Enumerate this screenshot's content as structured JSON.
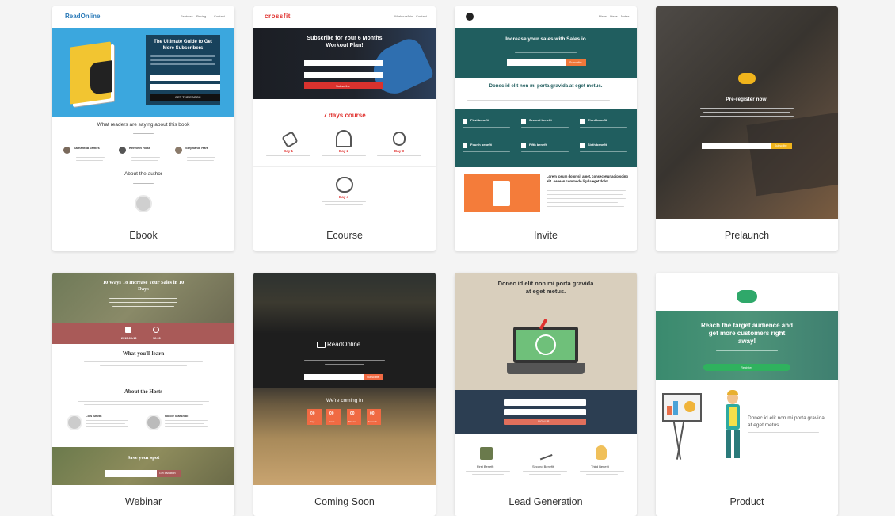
{
  "cards": [
    {
      "label": "Ebook",
      "thumb": {
        "logo": "ReadOnline",
        "nav": [
          "Features",
          "Pricing",
          "Contact"
        ],
        "headline": "The Ultimate Guide to Get More Subscribers",
        "cta": "GET THE EBOOK",
        "section_title": "What readers are saying about this book",
        "reviewers": [
          "Samantha James",
          "Kenneth Rose",
          "Stephanie Hart"
        ],
        "author_title": "About the author"
      }
    },
    {
      "label": "Ecourse",
      "thumb": {
        "logo": "crossfit",
        "nav": [
          "Workouts",
          "Join",
          "Contact"
        ],
        "headline": "Subscribe for Your 6 Months Workout Plan!",
        "cta": "Subscribe",
        "section_title": "7 days course",
        "days": [
          "Day 1",
          "Day 2",
          "Day 3",
          "Day 4"
        ]
      }
    },
    {
      "label": "Invite",
      "thumb": {
        "nav": [
          "Plans",
          "Ideas",
          "Notes"
        ],
        "headline": "Increase your sales with Sales.io",
        "cta": "Subscribe",
        "section_title": "Donec id elit non mi porta gravida at eget metus.",
        "benefits": [
          "First benefit",
          "Second benefit",
          "Third benefit",
          "Fourth benefit",
          "Fifth benefit",
          "Sixth benefit"
        ],
        "body_heading": "Lorem ipsum dolor sit amet, consectetur adipiscing elit. Aenean commodo ligula eget dolor."
      }
    },
    {
      "label": "Prelaunch",
      "thumb": {
        "headline": "Pre-register now!",
        "cta": "Subscribe"
      }
    },
    {
      "label": "Webinar",
      "thumb": {
        "headline": "10 Ways To Increase Your Sales in 10 Days",
        "date": "2015-09-18",
        "time": "12:00",
        "section_title": "What you'll learn",
        "hosts_title": "About the Hosts",
        "hosts": [
          "Lois Smith",
          "Nicole Marshall"
        ],
        "save_title": "Save your spot",
        "cta": "Get Invitation"
      }
    },
    {
      "label": "Coming Soon",
      "thumb": {
        "logo": "ReadOnline",
        "coming": "We're coming in",
        "cta": "Subscribe",
        "counters": [
          "00",
          "00",
          "00",
          "00"
        ],
        "counter_labels": [
          "Days",
          "Hours",
          "Minutes",
          "Seconds"
        ]
      }
    },
    {
      "label": "Lead Generation",
      "thumb": {
        "headline": "Donec id elit non mi porta gravida at eget metus.",
        "cta": "SIGN UP",
        "benefits": [
          "First Benefit",
          "Second Benefit",
          "Third Benefit"
        ]
      }
    },
    {
      "label": "Product",
      "thumb": {
        "headline": "Reach the target audience and get more customers right away!",
        "cta": "Register",
        "body_heading": "Donec id elit non mi porta gravida at eget metus."
      }
    }
  ]
}
